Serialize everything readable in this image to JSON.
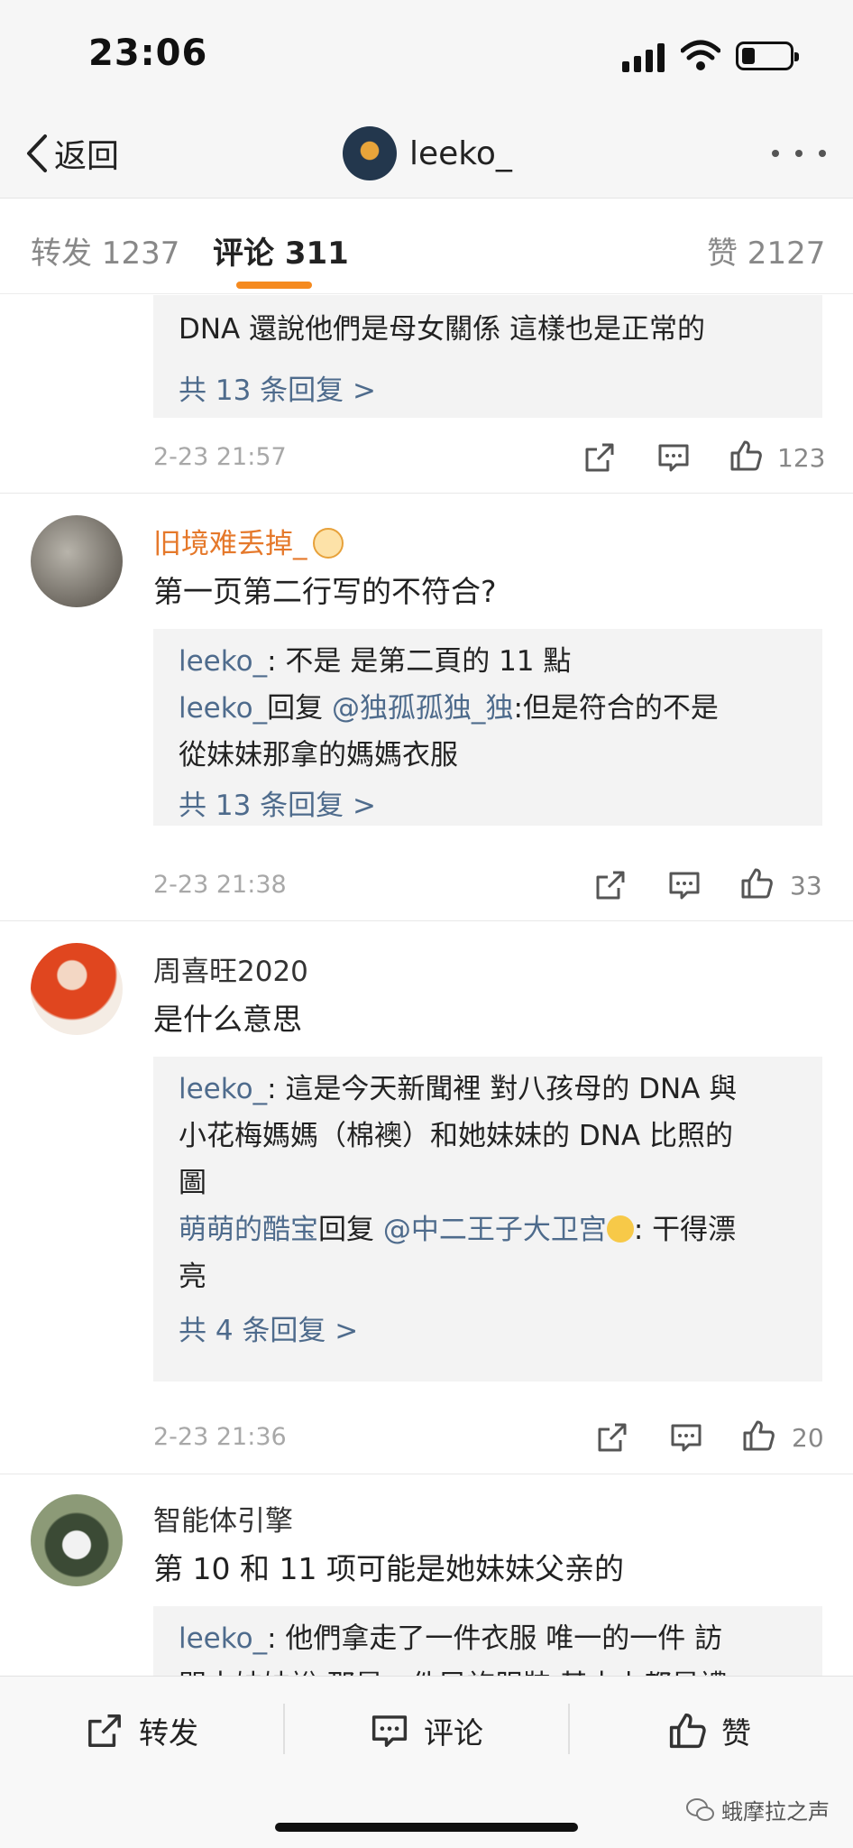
{
  "status_bar": {
    "time": "23:06"
  },
  "nav": {
    "back_label": "返回",
    "title": "leeko_"
  },
  "tabs": {
    "repost": "转发 1237",
    "comments": "评论 311",
    "likes": "赞 2127"
  },
  "comments": [
    {
      "reply_lines": [
        "DNA 還說他們是母女關係 這樣也是正常的"
      ],
      "more_replies": "共 13 条回复 >",
      "time": "2-23 21:57",
      "likes": "123"
    },
    {
      "user": "旧境难丢掉_",
      "text": "第一页第二行写的不符合?",
      "replies": [
        {
          "name": "leeko_",
          "text": ": 不是 是第二頁的 11 點"
        },
        {
          "name": "leeko_",
          "mid": "回复",
          "at": "@独孤孤独_独",
          "text": ":但是符合的不是",
          "cont": "從妹妹那拿的媽媽衣服"
        }
      ],
      "more_replies": "共 13 条回复 >",
      "time": "2-23 21:38",
      "likes": "33"
    },
    {
      "user": "周喜旺2020",
      "text": "是什么意思",
      "replies": [
        {
          "name": "leeko_",
          "text": ": 這是今天新聞裡 對八孩母的 DNA 與",
          "cont": "小花梅媽媽（棉襖）和她妹妹的 DNA 比照的",
          "cont2": "圖"
        },
        {
          "name": "萌萌的酷宝",
          "mid": "回复",
          "at": "@中二王子大卫宫",
          "text": ": 干得漂",
          "cont": "亮"
        }
      ],
      "more_replies": "共 4 条回复 >",
      "time": "2-23 21:36",
      "likes": "20"
    },
    {
      "user": "智能体引擎",
      "text": "第 10 和 11 项可能是她妹妹父亲的",
      "replies": [
        {
          "name": "leeko_",
          "text": ": 他們拿走了一件衣服 唯一的一件 訪",
          "cont": "問中妹妹說 那是一件民族服裝 基本上都是禮"
        }
      ]
    }
  ],
  "toolbar": {
    "repost": "转发",
    "comment": "评论",
    "like": "赞"
  },
  "watermark": "蛾摩拉之声",
  "colors": {
    "accent": "#f58a1f",
    "link": "#4e6b8c",
    "vip_name": "#e5782a"
  }
}
